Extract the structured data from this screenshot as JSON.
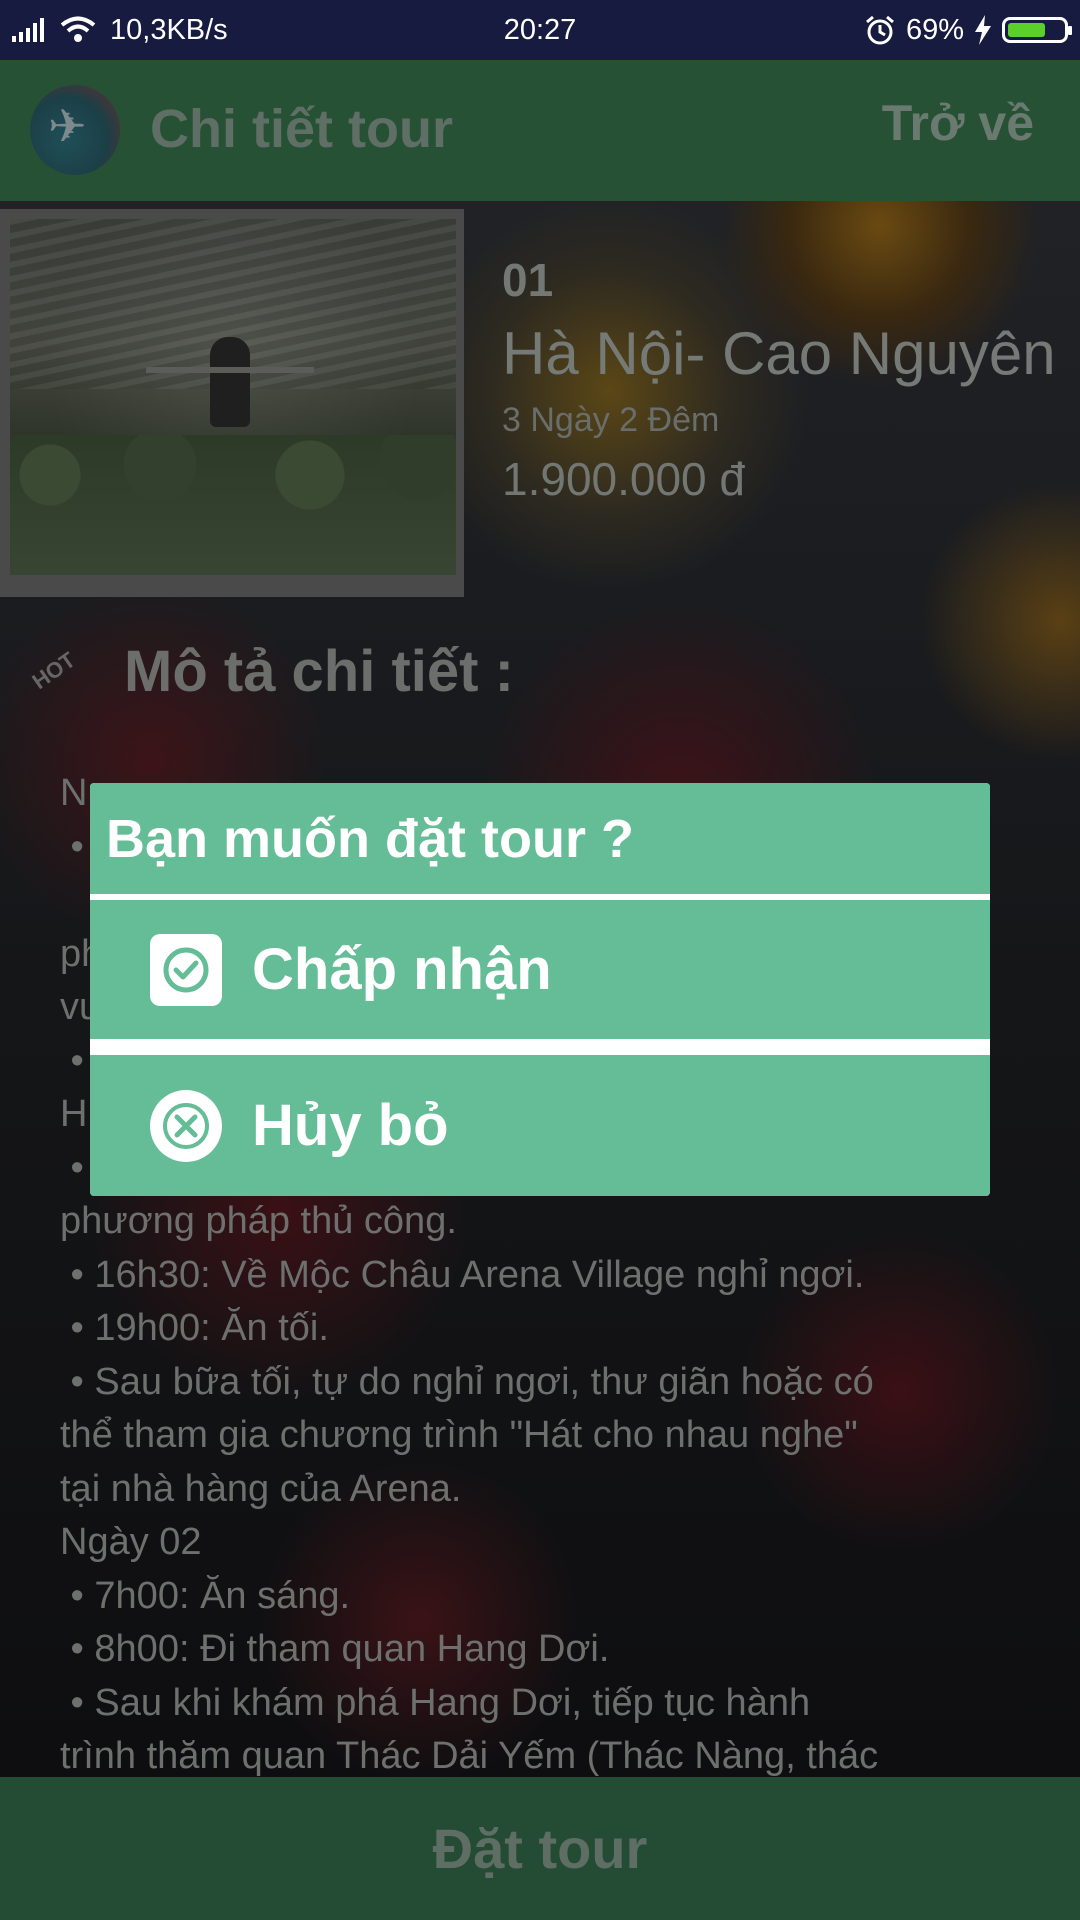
{
  "status_bar": {
    "net_speed": "10,3KB/s",
    "time": "20:27",
    "battery": "69%",
    "battery_level": 0.69
  },
  "app_bar": {
    "title": "Chi tiết tour",
    "back": "Trở về"
  },
  "tour": {
    "id": "01",
    "name": "Hà Nội- Cao Nguyên",
    "duration": "3 Ngày 2 Đêm",
    "price": "1.900.000 đ"
  },
  "description": {
    "title": "Mô tả chi tiết :",
    "lines": [
      "N",
      " •",
      "   •",
      "ph",
      "vu",
      " •",
      "H",
      " •                                             g                          o",
      "phương pháp thủ công.",
      " • 16h30: Về Mộc Châu Arena Village nghỉ ngơi.",
      " • 19h00: Ăn tối.",
      " • Sau bữa tối, tự do nghỉ ngơi, thư giãn hoặc có",
      "thể tham gia chương trình \"Hát cho nhau nghe\"",
      "tại nhà hàng của Arena.",
      "Ngày 02",
      " • 7h00: Ăn sáng.",
      " • 8h00: Đi tham quan Hang Dơi.",
      " • Sau khi khám phá Hang Dơi, tiếp tục hành",
      "trình thăm quan Thác Dải Yếm (Thác Nàng, thác"
    ]
  },
  "book_button": "Đặt tour",
  "dialog": {
    "title": "Bạn muốn đặt tour ?",
    "accept": "Chấp nhận",
    "cancel": "Hủy bỏ"
  },
  "colors": {
    "dialog_green": "#64bd96",
    "status_bar": "#171b3f",
    "app_bar_dimmed": "#265135"
  }
}
